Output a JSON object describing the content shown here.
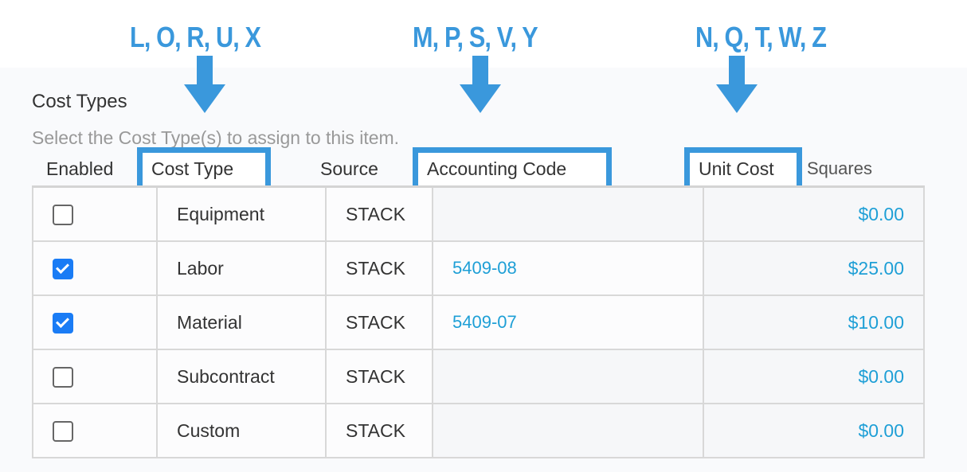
{
  "annotations": {
    "col1": "L, O, R, U, X",
    "col2": "M, P, S, V, Y",
    "col3": "N, Q, T, W, Z",
    "color": "#3a98dc"
  },
  "section": {
    "title": "Cost Types",
    "subtitle": "Select the Cost Type(s) to assign to this item."
  },
  "headers": {
    "enabled": "Enabled",
    "cost_type": "Cost Type",
    "source": "Source",
    "accounting_code": "Accounting Code",
    "unit_cost": "Unit Cost",
    "unit_suffix": "Squares"
  },
  "rows": [
    {
      "enabled": false,
      "cost_type": "Equipment",
      "source": "STACK",
      "accounting_code": "",
      "unit_cost": "$0.00"
    },
    {
      "enabled": true,
      "cost_type": "Labor",
      "source": "STACK",
      "accounting_code": "5409-08",
      "unit_cost": "$25.00"
    },
    {
      "enabled": true,
      "cost_type": "Material",
      "source": "STACK",
      "accounting_code": "5409-07",
      "unit_cost": "$10.00"
    },
    {
      "enabled": false,
      "cost_type": "Subcontract",
      "source": "STACK",
      "accounting_code": "",
      "unit_cost": "$0.00"
    },
    {
      "enabled": false,
      "cost_type": "Custom",
      "source": "STACK",
      "accounting_code": "",
      "unit_cost": "$0.00"
    }
  ]
}
